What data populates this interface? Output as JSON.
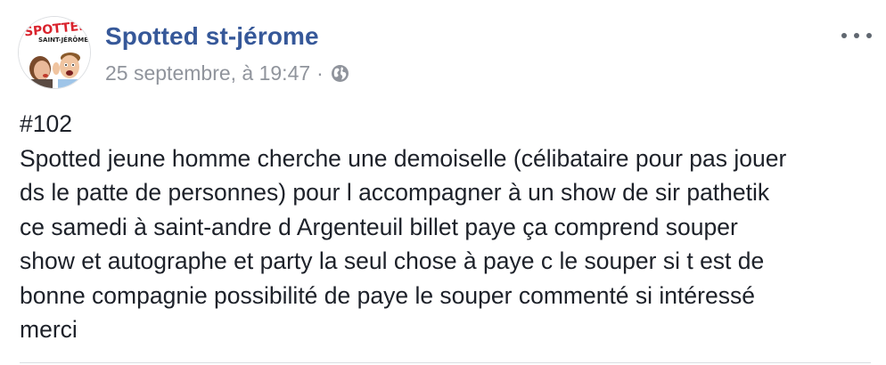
{
  "post": {
    "page_name": "Spotted st-jérome",
    "timestamp": "25 septembre, à 19:47",
    "separator": "·",
    "privacy_icon": "globe-icon",
    "more_icon": "more-options-icon",
    "avatar": {
      "logo_text": "SPOTTED",
      "logo_subtext": "SAINT-JÉRÔME"
    },
    "body_lines": [
      "#102",
      "Spotted jeune homme cherche une demoiselle (célibataire pour pas jouer",
      "ds le patte de personnes) pour l accompagner à un show de sir pathetik",
      "ce samedi à saint-andre d Argenteuil billet paye ça comprend souper",
      "show et autographe et party la seul chose à paye c le souper si t est de",
      "bonne compagnie possibilité de paye le souper commenté si intéressé",
      "merci"
    ]
  },
  "colors": {
    "link": "#365899",
    "meta": "#90949c",
    "text": "#1d2129",
    "logo_red": "#d9232d"
  }
}
